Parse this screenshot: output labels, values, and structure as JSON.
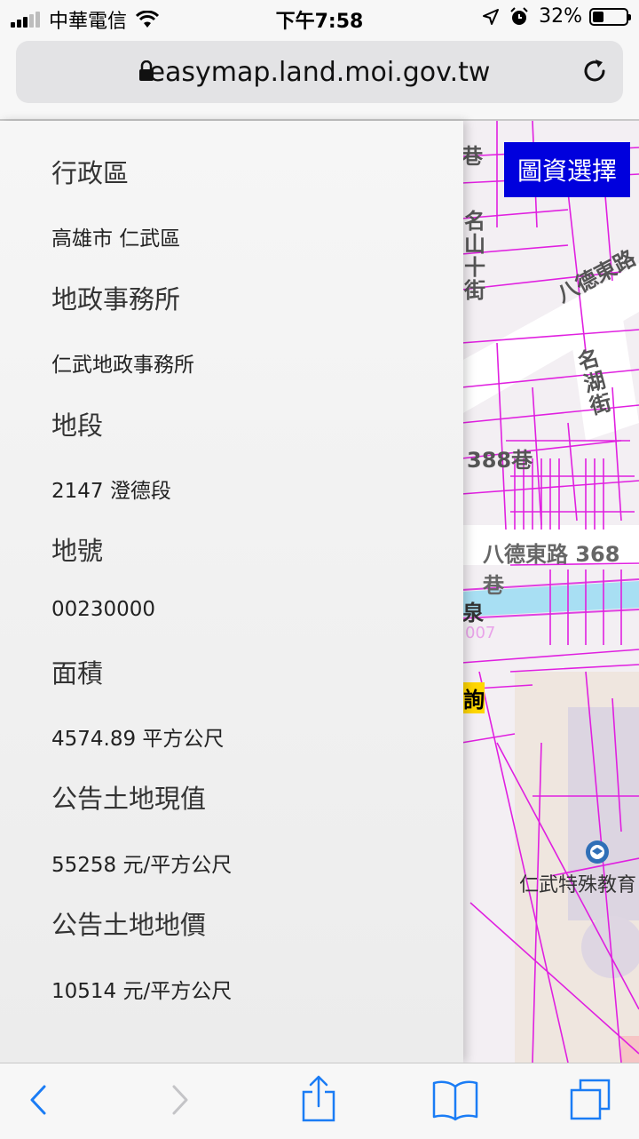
{
  "status_bar": {
    "carrier": "中華電信",
    "time": "下午7:58",
    "battery": "32%",
    "battery_level": 0.32
  },
  "browser": {
    "url": "easymap.land.moi.gov.tw"
  },
  "map": {
    "select_button": "圖資選擇",
    "labels": {
      "alley_top": "巷",
      "street_vertical_1": "名山十街",
      "road_1": "八德東路",
      "street_vertical_2": "名湖街",
      "alley_388": "388巷",
      "road_368": "八德東路 368巷",
      "fragment_1": "泉",
      "fragment_2": "007",
      "fragment_3": "詢",
      "school": "仁武特殊教育"
    }
  },
  "info": {
    "fields": [
      {
        "label": "行政區",
        "value": "高雄市 仁武區"
      },
      {
        "label": "地政事務所",
        "value": "仁武地政事務所"
      },
      {
        "label": "地段",
        "value": "2147 澄德段"
      },
      {
        "label": "地號",
        "value": "00230000"
      },
      {
        "label": "面積",
        "value": "4574.89 平方公尺"
      },
      {
        "label": "公告土地現值",
        "value": "55258 元/平方公尺"
      },
      {
        "label": "公告土地地價",
        "value": "10514 元/平方公尺"
      }
    ]
  },
  "toolbar": {
    "icons": [
      "back-icon",
      "forward-icon",
      "share-icon",
      "bookmarks-icon",
      "tabs-icon"
    ],
    "accent": "#1a7cf5"
  }
}
